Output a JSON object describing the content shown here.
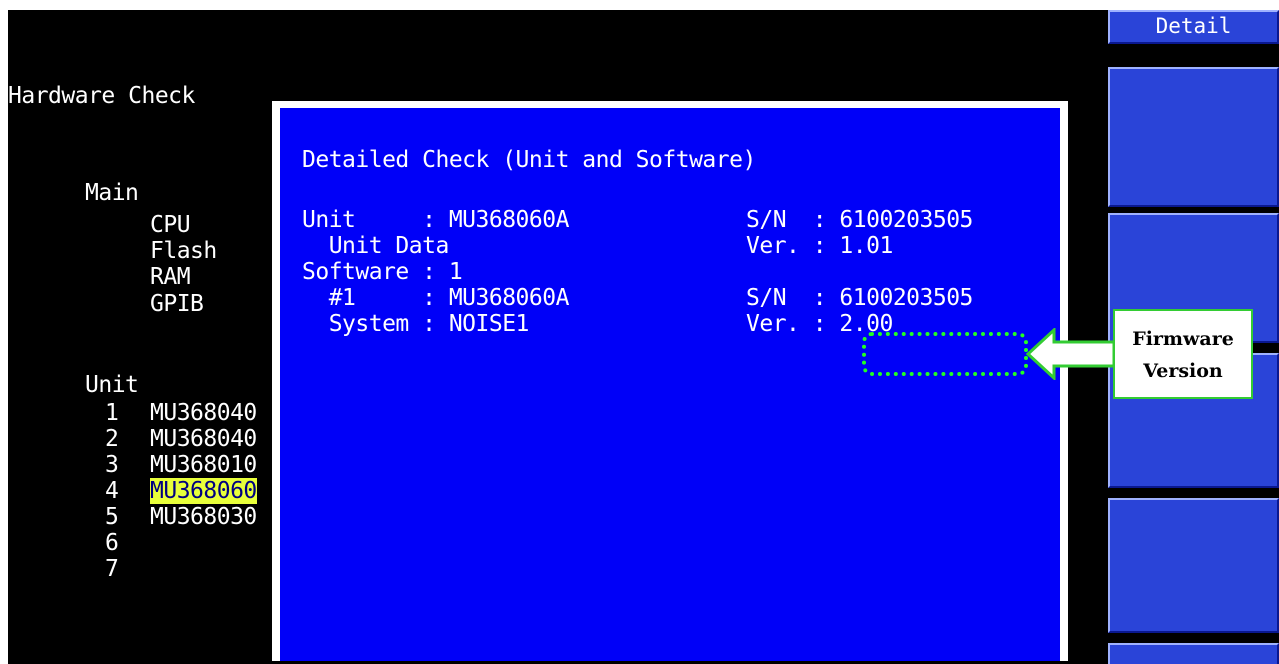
{
  "softkeys": {
    "top_label": "Detail"
  },
  "left": {
    "title": "Hardware Check",
    "main_label": "Main",
    "main_items": [
      "CPU",
      "Flash",
      "RAM",
      "GPIB"
    ],
    "unit_label": "Unit",
    "units": [
      {
        "num": "1",
        "name": "MU368040"
      },
      {
        "num": "2",
        "name": "MU368040"
      },
      {
        "num": "3",
        "name": "MU368010"
      },
      {
        "num": "4",
        "name": "MU368060"
      },
      {
        "num": "5",
        "name": "MU368030"
      },
      {
        "num": "6",
        "name": ""
      },
      {
        "num": "7",
        "name": ""
      }
    ]
  },
  "dialog": {
    "title": "Detailed Check (Unit and Software)",
    "rows": [
      {
        "left": "Unit     : MU368060A",
        "right": "S/N  : 6100203505"
      },
      {
        "left": "  Unit Data",
        "right": "Ver. : 1.01"
      },
      {
        "left": "Software : 1",
        "right": ""
      },
      {
        "left": "  #1     : MU368060A",
        "right": "S/N  : 6100203505"
      },
      {
        "left": "  System : NOISE1",
        "right": "Ver. : 2.00"
      }
    ]
  },
  "annotation": {
    "line1": "Firmware",
    "line2": "Version",
    "color": "#22ff22"
  }
}
